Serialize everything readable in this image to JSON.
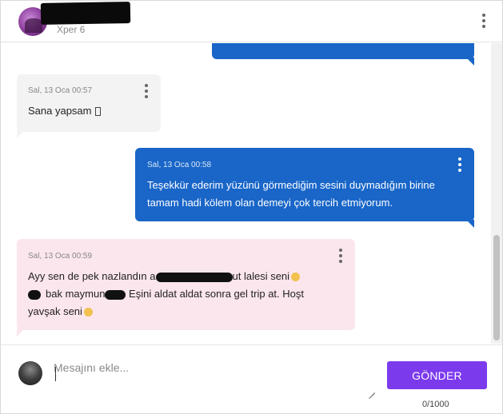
{
  "header": {
    "subtitle": "Xper 6",
    "menu_icon": "more-vertical-icon"
  },
  "messages": [
    {
      "direction": "incoming",
      "timestamp": "Sal, 13 Oca 00:57",
      "text": "Sana yapsam"
    },
    {
      "direction": "outgoing",
      "timestamp": "Sal, 13 Oca 00:58",
      "lines": [
        "Teşekkür ederim yüzünü görmediğim sesini duymadığım birine",
        "tamam hadi kölem olan demeyi çok tercih etmiyorum."
      ]
    },
    {
      "direction": "incoming",
      "timestamp": "Sal, 13 Oca 00:59",
      "line1_a": "Ayy sen de pek nazlandın a",
      "line1_b": "ut lalesi seni",
      "line2_a": "bak maymun",
      "line2_b": " Eşini aldat aldat sonra gel trip at. Hoşt",
      "line3": "yavşak seni"
    }
  ],
  "composer": {
    "placeholder": "Mesajını ekle...",
    "send_label": "GÖNDER",
    "counter": "0/1000"
  },
  "colors": {
    "outgoing_bubble": "#1966c8",
    "incoming_bubble": "#f3f3f3",
    "highlight_bubble": "#fce6ee",
    "send_button": "#7c3aed"
  }
}
